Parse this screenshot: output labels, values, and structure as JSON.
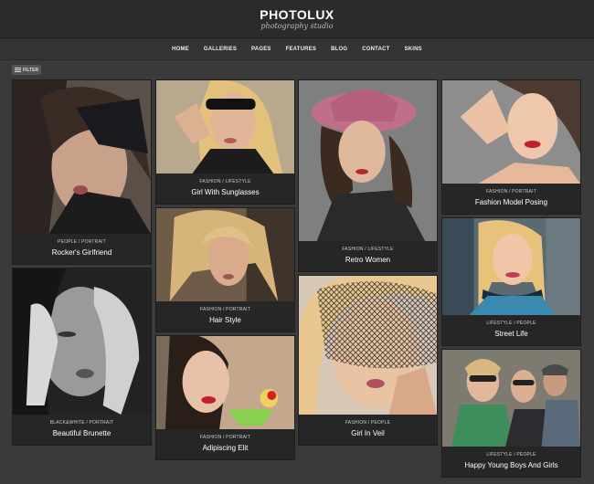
{
  "site": {
    "title": "PHOTOLUX",
    "subtitle": "photography studio"
  },
  "nav": {
    "items": [
      "HOME",
      "GALLERIES",
      "PAGES",
      "FEATURES",
      "BLOG",
      "CONTACT",
      "SKINS"
    ]
  },
  "filter": {
    "label": "FILTER"
  },
  "gallery": {
    "items": [
      {
        "category": "PEOPLE / PORTRAIT",
        "title": "Rocker's Girlfriend"
      },
      {
        "category": "BLACK&WHITE / PORTRAIT",
        "title": "Beautiful Brunette"
      },
      {
        "category": "FASHION / LIFESTYLE",
        "title": "Girl With Sunglasses"
      },
      {
        "category": "FASHION / PORTRAIT",
        "title": "Hair Style"
      },
      {
        "category": "FASHION / PORTRAIT",
        "title": "Adipiscing Elit"
      },
      {
        "category": "FASHION / LIFESTYLE",
        "title": "Retro Women"
      },
      {
        "category": "FASHION / PEOPLE",
        "title": "Girl In Veil"
      },
      {
        "category": "FASHION / PORTRAIT",
        "title": "Fashion Model Posing"
      },
      {
        "category": "LIFESTYLE / PEOPLE",
        "title": "Street Life"
      },
      {
        "category": "LIFESTYLE / PEOPLE",
        "title": "Happy Young Boys And Girls"
      }
    ]
  }
}
